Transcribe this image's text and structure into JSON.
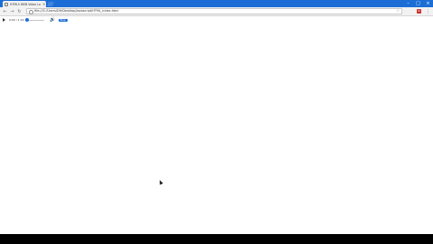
{
  "browser": {
    "tab": {
      "title": "HTML5 WEB Video Lab",
      "close_glyph": "×"
    },
    "window_controls": {
      "minimize": "–",
      "maximize": "□",
      "close": "×"
    },
    "nav": {
      "back": "←",
      "forward": "→",
      "reload": "↻"
    },
    "address": {
      "url": "file:///C:/Users/DH/Desktop/Javascript/HTML_index.html"
    },
    "icons": {
      "star": "☆",
      "menu": "⋮",
      "extension_letter": "A"
    }
  },
  "player": {
    "time": "0:00 / 1:14",
    "progress_fraction": 0.0,
    "volume_glyph": "🔊",
    "button_label": "Stop"
  },
  "colors": {
    "titlebar": "#1c6ed6",
    "accent": "#1c6ed6",
    "page_background": "#ffffff"
  }
}
